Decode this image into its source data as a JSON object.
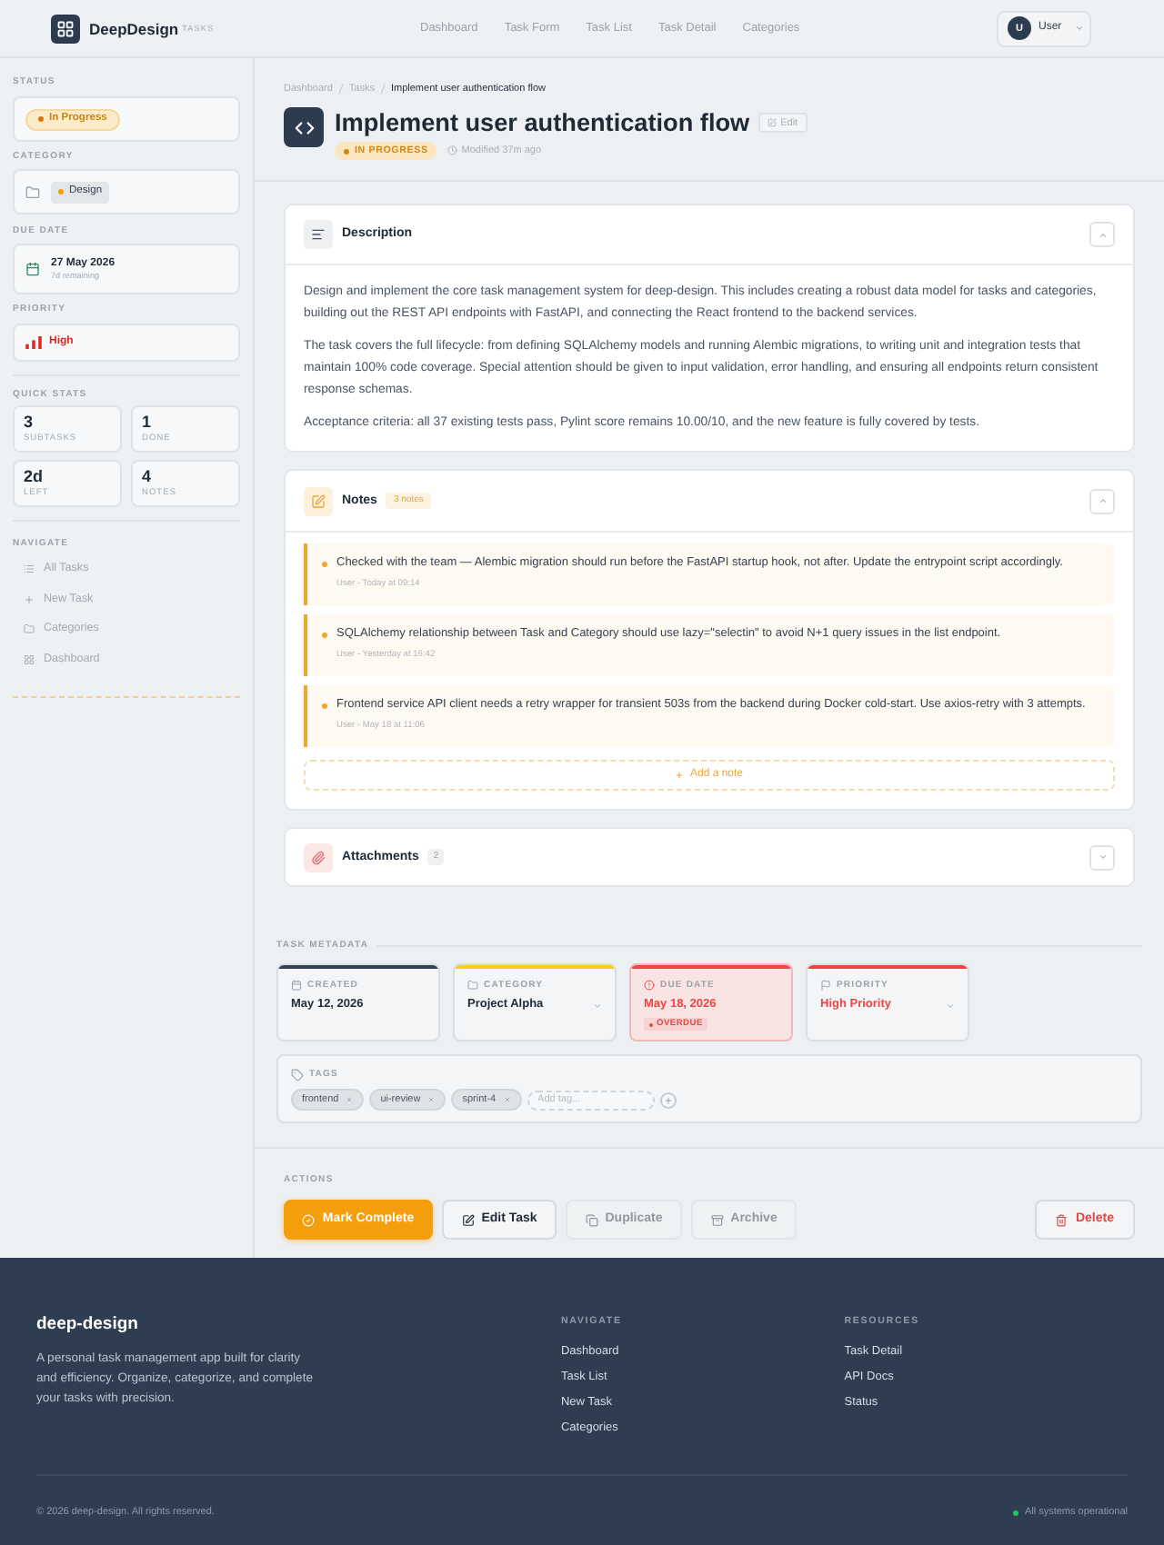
{
  "header": {
    "brand": "DeepDesign",
    "brand_tag": "TASKS",
    "nav": [
      {
        "label": "Dashboard",
        "selected": false
      },
      {
        "label": "Task Form",
        "selected": false
      },
      {
        "label": "Task List",
        "selected": false
      },
      {
        "label": "Task Detail",
        "selected": false
      },
      {
        "label": "Categories",
        "selected": false
      }
    ],
    "user": {
      "initial": "U",
      "name": "User"
    }
  },
  "sidebar": {
    "status": {
      "label": "STATUS",
      "value": "In Progress"
    },
    "category": {
      "label": "CATEGORY",
      "value": "Design"
    },
    "due_date": {
      "label": "DUE DATE",
      "date": "27 May 2026",
      "remaining": "7d remaining"
    },
    "priority": {
      "label": "PRIORITY",
      "value": "High"
    },
    "quick_stats": {
      "label": "QUICK STATS",
      "items": [
        {
          "value": "3",
          "label": "SUBTASKS"
        },
        {
          "value": "1",
          "label": "DONE"
        },
        {
          "value": "2d",
          "label": "LEFT"
        },
        {
          "value": "4",
          "label": "NOTES"
        }
      ]
    },
    "navigate": {
      "label": "NAVIGATE",
      "items": [
        {
          "kind": "list",
          "label": "All Tasks",
          "selected": false
        },
        {
          "kind": "add",
          "label": "New Task",
          "selected": false
        },
        {
          "kind": "folder",
          "label": "Categories",
          "selected": false
        },
        {
          "kind": "grid",
          "label": "Dashboard",
          "selected": false
        }
      ]
    }
  },
  "task": {
    "breadcrumb": [
      {
        "label": "Dashboard",
        "current": false
      },
      {
        "label": "Tasks",
        "current": false
      },
      {
        "label": "Implement user authentication flow",
        "current": true
      }
    ],
    "title": "Implement user authentication flow",
    "edit": "Edit",
    "status": "IN PROGRESS",
    "modified": "Modified 37m ago"
  },
  "description": {
    "title": "Description",
    "expanded": true,
    "paragraphs": [
      "Design and implement the core task management system for deep-design. This includes creating a robust data model for tasks and categories, building out the REST API endpoints with FastAPI, and connecting the React frontend to the backend services.",
      "The task covers the full lifecycle: from defining SQLAlchemy models and running Alembic migrations, to writing unit and integration tests that maintain 100% code coverage. Special attention should be given to input validation, error handling, and ensuring all endpoints return consistent response schemas.",
      "Acceptance criteria: all 37 existing tests pass, Pylint score remains 10.00/10, and the new feature is fully covered by tests."
    ]
  },
  "notes": {
    "title": "Notes",
    "count": "3 notes",
    "expanded": true,
    "items": [
      {
        "text": "Checked with the team — Alembic migration should run before the FastAPI startup hook, not after. Update the entrypoint script accordingly.",
        "meta": "User - Today at 09:14"
      },
      {
        "text": "SQLAlchemy relationship between Task and Category should use lazy=\"selectin\" to avoid N+1 query issues in the list endpoint.",
        "meta": "User - Yesterday at 16:42"
      },
      {
        "text": "Frontend service API client needs a retry wrapper for transient 503s from the backend during Docker cold-start. Use axios-retry with 3 attempts.",
        "meta": "User - May 18 at 11:06"
      }
    ],
    "add": "Add a note"
  },
  "attachments": {
    "title": "Attachments",
    "count": "2",
    "expanded": false
  },
  "metadata": {
    "title": "TASK METADATA",
    "fields": [
      {
        "kind": "created",
        "label": "CREATED",
        "value": "May 12, 2026",
        "color": "#334155",
        "tinted": false,
        "dropdown": false,
        "overdue": false
      },
      {
        "kind": "category",
        "label": "CATEGORY",
        "value": "Project Alpha",
        "color": "#facc15",
        "tinted": false,
        "dropdown": true,
        "overdue": false
      },
      {
        "kind": "due_date",
        "label": "DUE DATE",
        "value": "May 18, 2026",
        "color": "#ef4444",
        "tinted": true,
        "dropdown": false,
        "overdue": true,
        "badge": "OVERDUE"
      },
      {
        "kind": "priority",
        "label": "PRIORITY",
        "value": "High Priority",
        "color": "#ef4444",
        "tinted": true,
        "dropdown": true,
        "overdue": false
      }
    ],
    "tags": {
      "label": "TAGS",
      "items": [
        "frontend",
        "ui-review",
        "sprint-4"
      ],
      "placeholder": "Add tag..."
    }
  },
  "actions": {
    "title": "ACTIONS",
    "buttons": [
      {
        "kind": "complete",
        "label": "Mark Complete",
        "disabled": false
      },
      {
        "kind": "edit",
        "label": "Edit Task",
        "disabled": false
      },
      {
        "kind": "duplicate",
        "label": "Duplicate",
        "disabled": true
      },
      {
        "kind": "archive",
        "label": "Archive",
        "disabled": true
      },
      {
        "kind": "delete",
        "label": "Delete",
        "disabled": false
      }
    ]
  },
  "footer": {
    "brand": "deep-design",
    "about": "A personal task management app built for clarity and efficiency. Organize, categorize, and complete your tasks with precision.",
    "columns": [
      {
        "title": "NAVIGATE",
        "links": [
          "Dashboard",
          "Task List",
          "New Task",
          "Categories"
        ]
      },
      {
        "title": "RESOURCES",
        "links": [
          "Task Detail",
          "API Docs",
          "Status"
        ]
      }
    ],
    "copyright": "© 2026 deep-design. All rights reserved.",
    "status": "All systems operational"
  }
}
